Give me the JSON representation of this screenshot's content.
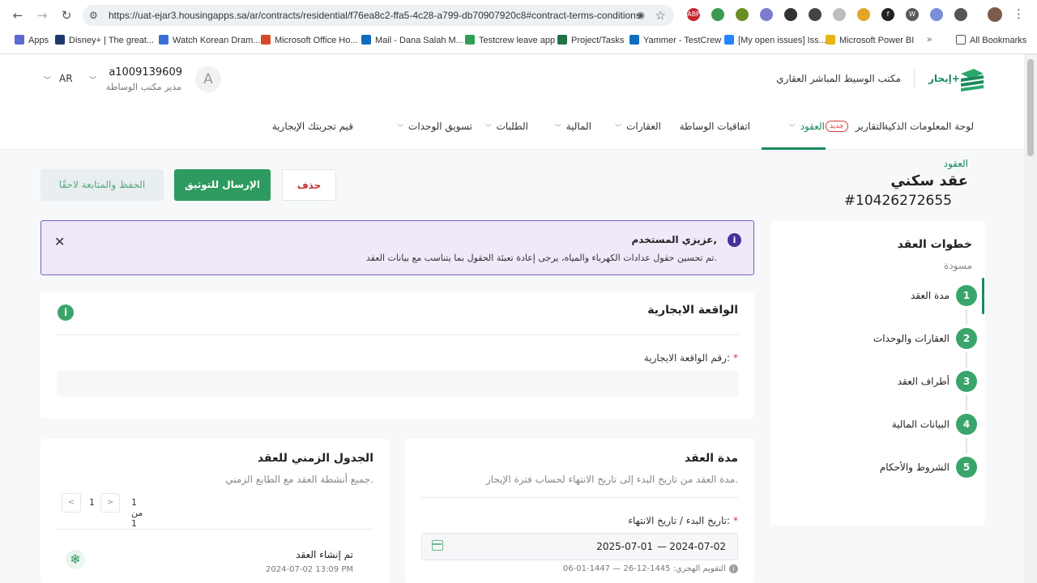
{
  "browser": {
    "url": "https://uat-ejar3.housingapps.sa/ar/contracts/residential/f76ea8c2-ffa5-4c28-a799-db70907920c8#contract-terms-conditions",
    "bookmarks": [
      {
        "label": "Apps",
        "color": "#5b6ad0"
      },
      {
        "label": "Disney+ | The great...",
        "color": "#1c3a6e"
      },
      {
        "label": "Watch Korean Dram...",
        "color": "#3a6fd8"
      },
      {
        "label": "Microsoft Office Ho...",
        "color": "#d64a2a"
      },
      {
        "label": "Mail - Dana Salah M...",
        "color": "#0f6cbd"
      },
      {
        "label": "Testcrew leave app",
        "color": "#2f9e57"
      },
      {
        "label": "Project/Tasks",
        "color": "#217346"
      },
      {
        "label": "Yammer - TestCrew",
        "color": "#106ebe"
      },
      {
        "label": "[My open issues] Iss...",
        "color": "#2684ff"
      },
      {
        "label": "Microsoft Power BI",
        "color": "#e8b416"
      }
    ],
    "all_bookmarks": "All Bookmarks",
    "extensions": [
      {
        "name": "abp-icon",
        "label": "ABP",
        "color": "#c7252f"
      },
      {
        "name": "shield-ext-icon",
        "label": "",
        "color": "#3d9a52"
      },
      {
        "name": "puzzle-ext-icon",
        "label": "",
        "color": "#6b8e23"
      },
      {
        "name": "compass-ext-icon",
        "label": "",
        "color": "#7b7bd0"
      },
      {
        "name": "pen-ext-icon",
        "label": "",
        "color": "#333333"
      },
      {
        "name": "chat-ext-icon",
        "label": "",
        "color": "#444444"
      },
      {
        "name": "no-ext-icon",
        "label": "",
        "color": "#bdbdbd"
      },
      {
        "name": "emoji-ext-icon",
        "label": "",
        "color": "#e2a52a"
      },
      {
        "name": "f-ext-icon",
        "label": "f",
        "color": "#222222"
      },
      {
        "name": "w-ext-icon",
        "label": "W",
        "color": "#5a5a5a"
      },
      {
        "name": "target-ext-icon",
        "label": "",
        "color": "#7a8fd8"
      },
      {
        "name": "extensions-icon",
        "label": "",
        "color": "#555555"
      }
    ]
  },
  "header": {
    "logo_text": "إيجار+",
    "office_name": "مكتب الوسيط المباشر العقاري",
    "avatar_letter": "A",
    "user_id": "a1009139609",
    "user_role": "مدير مكتب الوساطة",
    "lang": "AR",
    "nav": [
      {
        "label": "لوحة المعلومات الذكية",
        "chev": false
      },
      {
        "label": "التقارير",
        "chev": false
      },
      {
        "label": "العقود",
        "chev": true,
        "active": true
      },
      {
        "label": "اتفاقيات الوساطة",
        "chev": false
      },
      {
        "label": "العقارات",
        "chev": true
      },
      {
        "label": "المالية",
        "chev": true
      },
      {
        "label": "الطلبات",
        "chev": true
      },
      {
        "label": "تسويق الوحدات",
        "chev": true
      },
      {
        "label": "قيم تجربتك الإيجارية",
        "chev": false
      }
    ],
    "new_badge": "جديد"
  },
  "page": {
    "breadcrumb": "العقود",
    "title": "عقد سكني",
    "contract_number": "#10426272655",
    "buttons": {
      "delete": "حذف",
      "send": "الإرسال للتوثيق",
      "save": "الحفظ والمتابعة لاحقًا"
    }
  },
  "notice": {
    "title": "عزيزي المستخدم,",
    "body": "تم تحسين حقول عدادات الكهرباء والمياه، يرجى إعادة تعبئة الحقول بما يتناسب مع بيانات العقد."
  },
  "steps": {
    "title": "خطوات العقد",
    "status": "مسودة",
    "items": [
      {
        "num": "1",
        "label": "مدة العقد"
      },
      {
        "num": "2",
        "label": "العقارات والوحدات"
      },
      {
        "num": "3",
        "label": "أطراف العقد"
      },
      {
        "num": "4",
        "label": "البيانات المالية"
      },
      {
        "num": "5",
        "label": "الشروط والأحكام"
      }
    ]
  },
  "lease": {
    "title": "الواقعة الايجارية",
    "field_label": "رقم الواقعة الايجارية:",
    "field_value": ""
  },
  "duration": {
    "title": "مدة العقد",
    "description": "مدة العقد من تاريخ البدء إلى تاريخ الانتهاء لحساب فترة الإيجار.",
    "field_label": "تاريخ البدء / تاريخ الانتهاء:",
    "start_date": "2024-07-02",
    "separator": "—",
    "end_date": "2025-07-01",
    "hijri": "التقويم الهجري: 1445-12-26 — 1447-01-06"
  },
  "timeline": {
    "title": "الجدول الزمني للعقد",
    "description": "جميع أنشطة العقد مع الطابع الزمني.",
    "pager_text": "1 من 1",
    "page": "1",
    "event": "تم إنشاء العقد",
    "event_time": "2024-07-02 13:09 PM"
  }
}
